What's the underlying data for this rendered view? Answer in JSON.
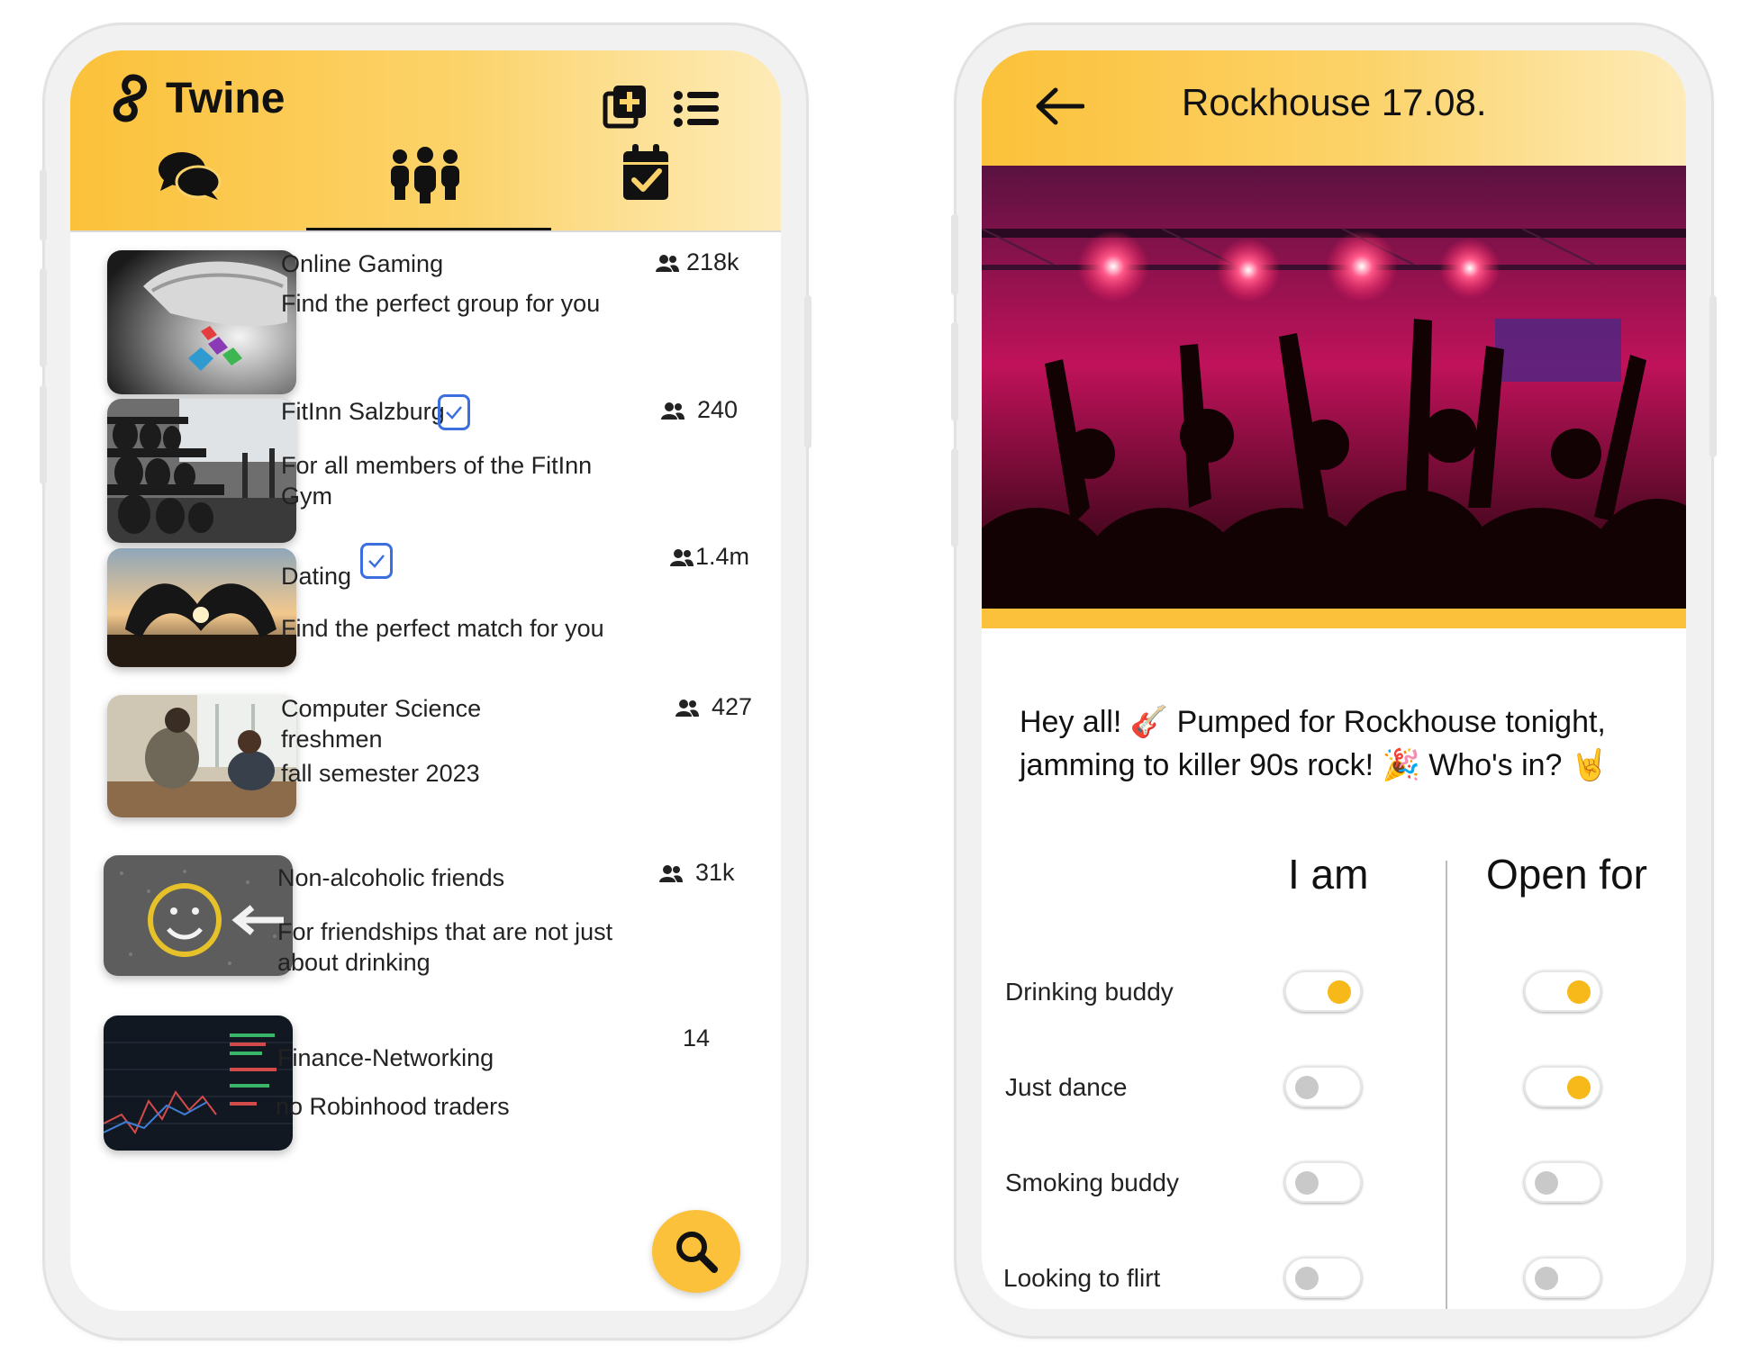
{
  "left_app": {
    "brand": "Twine",
    "header_icons": [
      "add-group-icon",
      "list-icon"
    ],
    "tabs": [
      {
        "name": "chats",
        "icon": "chat-bubbles-icon",
        "active": false
      },
      {
        "name": "groups",
        "icon": "group-people-icon",
        "active": true
      },
      {
        "name": "events",
        "icon": "calendar-check-icon",
        "active": false
      }
    ],
    "groups": [
      {
        "title": "Online Gaming",
        "count": "218k",
        "description": "Find the perfect group for you",
        "verified": false
      },
      {
        "title": "FitInn Salzburg",
        "count": "240",
        "description": "For all members of the FitInn Gym",
        "verified": true
      },
      {
        "title": "Dating",
        "count": "1.4m",
        "description": "Find the perfect match for you",
        "verified": true
      },
      {
        "title": "Computer Science freshmen",
        "count": "427",
        "description": "fall semester 2023",
        "verified": false
      },
      {
        "title": "Non-alcoholic friends",
        "count": "31k",
        "description": "For friendships that are not just about drinking",
        "verified": false
      },
      {
        "title": "Finance-Networking",
        "count": "14",
        "description": "no Robinhood traders",
        "verified": false
      }
    ],
    "fab_icon": "search-icon",
    "accent": "#fbc13a"
  },
  "right_app": {
    "title": "Rockhouse 17.08.",
    "back_icon": "back-arrow-icon",
    "message": "Hey all! 🎸 Pumped for Rockhouse tonight, jamming to killer 90s rock! 🎉 Who's in? 🤘",
    "col_i_am": "I am",
    "col_open_for": "Open for",
    "options": [
      {
        "label": "Drinking buddy",
        "i_am": true,
        "open_for": true
      },
      {
        "label": "Just dance",
        "i_am": false,
        "open_for": true
      },
      {
        "label": "Smoking buddy",
        "i_am": false,
        "open_for": false
      },
      {
        "label": "Looking to flirt",
        "i_am": false,
        "open_for": false
      }
    ]
  }
}
